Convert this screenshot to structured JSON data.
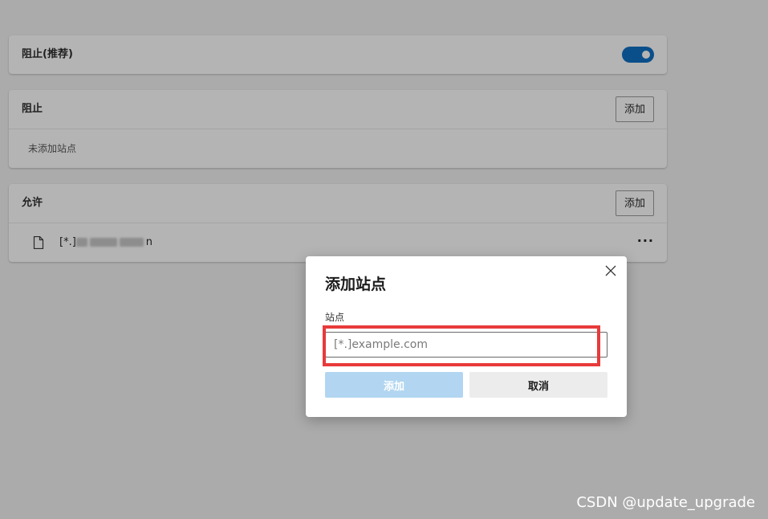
{
  "block_recommended": {
    "title": "阻止(推荐)",
    "toggle_on": true,
    "toggle_color": "#0a4f8a"
  },
  "block_list": {
    "title": "阻止",
    "add_label": "添加",
    "empty_text": "未添加站点"
  },
  "allow_list": {
    "title": "允许",
    "add_label": "添加",
    "sites": [
      {
        "prefix": "[*.]",
        "suffix": "n",
        "icon": "file-icon",
        "more_label": "···"
      }
    ]
  },
  "dialog": {
    "title": "添加站点",
    "field_label": "站点",
    "input_placeholder": "[*.]example.com",
    "input_value": "",
    "add_label": "添加",
    "cancel_label": "取消",
    "close_icon": "close-icon",
    "highlight_color": "#e83a3a"
  },
  "watermark": "CSDN @update_upgrade"
}
